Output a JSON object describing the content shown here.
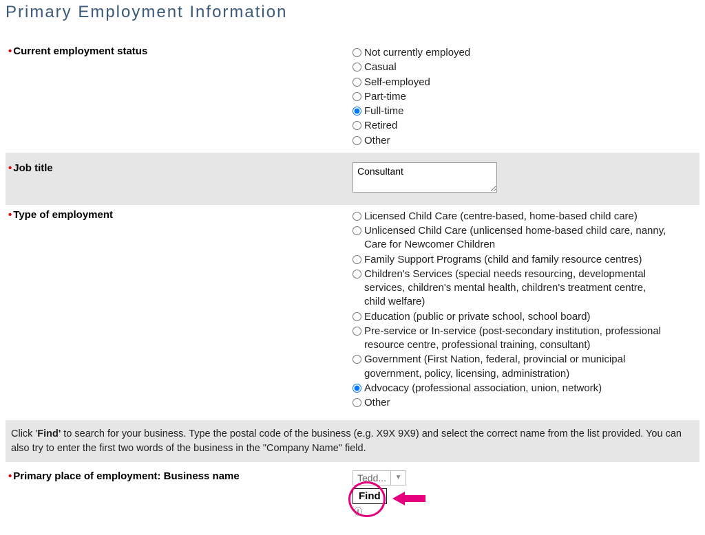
{
  "section_title": "Primary Employment Information",
  "labels": {
    "employment_status": "Current employment status",
    "job_title": "Job title",
    "type_of_employment": "Type of employment",
    "business_name": "Primary place of employment: Business name"
  },
  "employment_status": {
    "options": [
      "Not currently employed",
      "Casual",
      "Self-employed",
      "Part-time",
      "Full-time",
      "Retired",
      "Other"
    ],
    "selected_index": 4
  },
  "job_title_value": "Consultant",
  "type_of_employment": {
    "options": [
      "Licensed Child Care (centre-based, home-based child care)",
      "Unlicensed Child Care (unlicensed home-based child care, nanny, Care for Newcomer Children",
      "Family Support Programs (child and family resource centres)",
      "Children's Services (special needs resourcing, developmental services, children's mental health, children's treatment centre, child welfare)",
      "Education (public or private school, school board)",
      "Pre-service or In-service (post-secondary institution, professional resource centre, professional training, consultant)",
      "Government (First Nation, federal, provincial or municipal government, policy, licensing, administration)",
      "Advocacy (professional association, union, network)",
      "Other"
    ],
    "selected_index": 7
  },
  "instruction": {
    "prefix": "Click '",
    "bold": "Find'",
    "rest": " to search for your business. Type the postal code of the business (e.g. X9X 9X9) and select the correct name from the list provided. You can also try to enter the first two words of the business in the \"Company Name\" field."
  },
  "business_selector_value": "Tedd...",
  "find_button_label": "Find",
  "annotation_arrow_color": "#e6007e"
}
